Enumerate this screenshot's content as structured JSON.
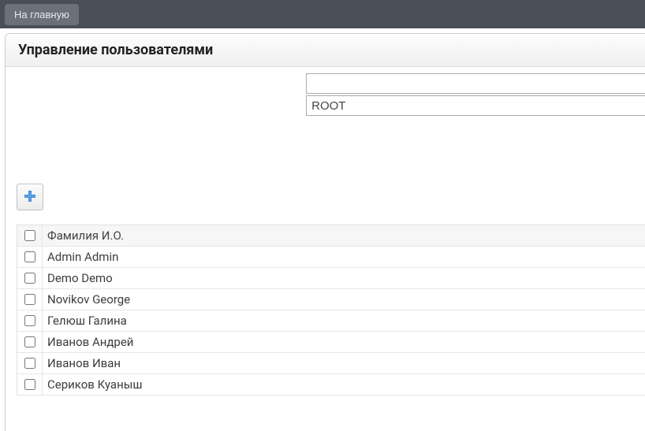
{
  "topbar": {
    "home_label": "На главную"
  },
  "panel": {
    "title": "Управление пользователями"
  },
  "filters": {
    "search_value": "",
    "dropdown_value": "ROOT"
  },
  "toolbar": {
    "add_tooltip": "Add"
  },
  "table": {
    "header": {
      "name_label": "Фамилия И.О."
    },
    "rows": [
      {
        "name": "Admin Admin"
      },
      {
        "name": "Demo Demo"
      },
      {
        "name": "Novikov George"
      },
      {
        "name": "Гелюш Галина"
      },
      {
        "name": "Иванов Андрей"
      },
      {
        "name": "Иванов Иван"
      },
      {
        "name": "Сериков Куаныш"
      }
    ]
  }
}
